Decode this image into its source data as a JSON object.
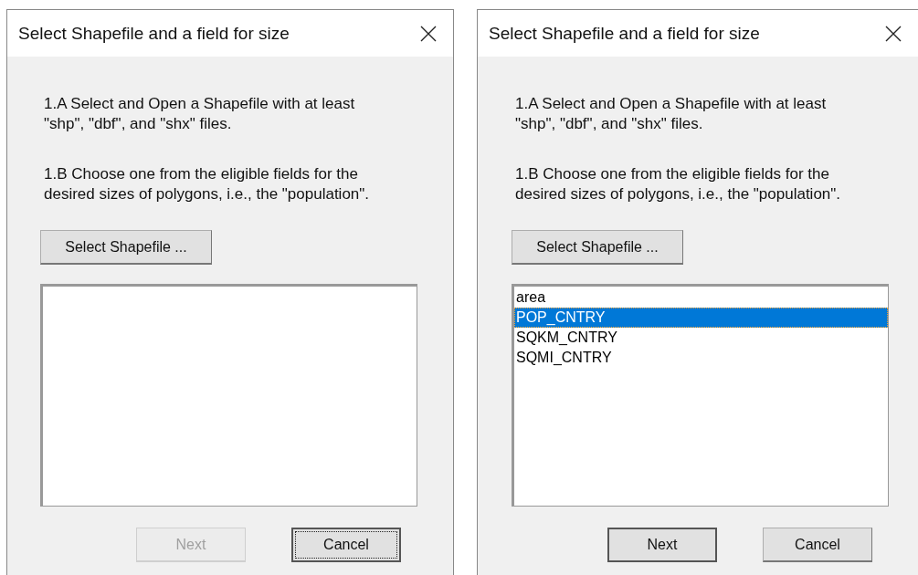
{
  "dialogs": [
    {
      "title": "Select Shapefile and a field for size",
      "instructions": [
        "1.A Select and Open a Shapefile with at least \"shp\", \"dbf\", and \"shx\" files.",
        "1.B Choose one from the eligible fields for the desired sizes of polygons, i.e., the \"population\"."
      ],
      "select_button": "Select Shapefile ...",
      "next_button": {
        "label": "Next",
        "disabled": true,
        "default": false
      },
      "cancel_button": {
        "label": "Cancel",
        "focused": true
      }
    },
    {
      "title": "Select Shapefile and a field for size",
      "instructions": [
        "1.A Select and Open a Shapefile with at least \"shp\", \"dbf\", and \"shx\" files.",
        "1.B Choose one from the eligible fields for the desired sizes of polygons, i.e., the \"population\"."
      ],
      "select_button": "Select Shapefile ...",
      "fields": [
        {
          "label": "area",
          "selected": false
        },
        {
          "label": "POP_CNTRY",
          "selected": true
        },
        {
          "label": "SQKM_CNTRY",
          "selected": false
        },
        {
          "label": "SQMI_CNTRY",
          "selected": false
        }
      ],
      "next_button": {
        "label": "Next",
        "disabled": false,
        "default": true
      },
      "cancel_button": {
        "label": "Cancel",
        "focused": false
      }
    }
  ]
}
